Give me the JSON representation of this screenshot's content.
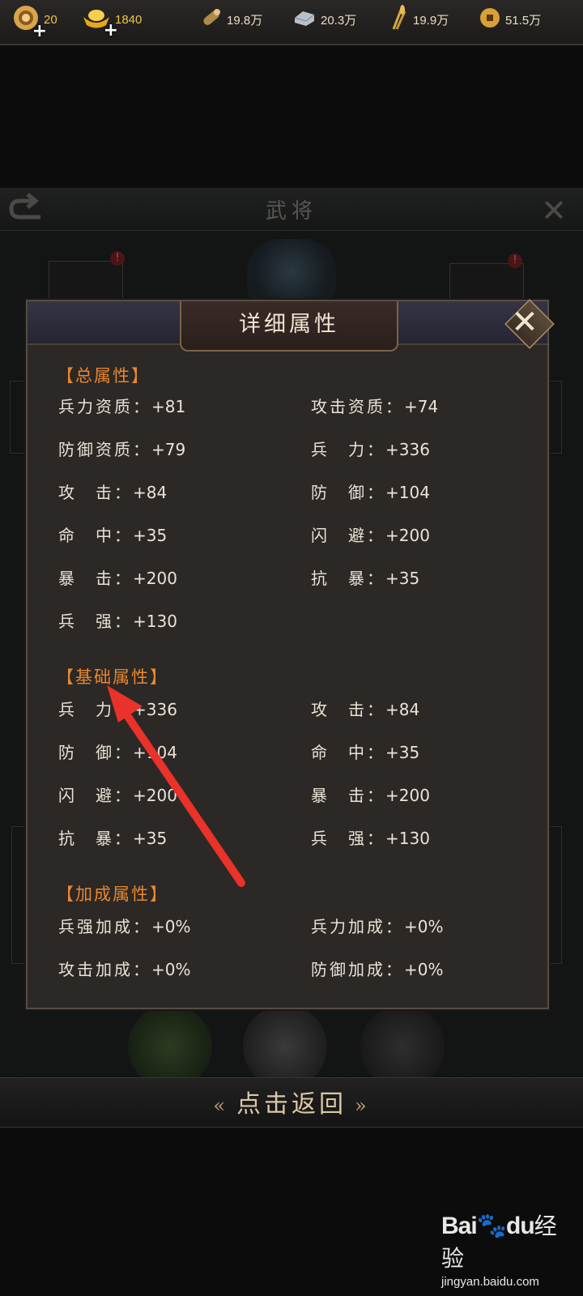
{
  "resources": {
    "jade": "20",
    "gold": "1840",
    "wood": "19.8万",
    "iron": "20.3万",
    "grain": "19.9万",
    "coin": "51.5万"
  },
  "background": {
    "title": "武将"
  },
  "dialog": {
    "title": "详细属性",
    "total": {
      "title": "【总属性】",
      "rows": [
        [
          "兵力资质：",
          "+81",
          "攻击资质：",
          "+74"
        ],
        [
          "防御资质：",
          "+79",
          "兵　力：",
          "+336"
        ],
        [
          "攻　击：",
          "+84",
          "防　御：",
          "+104"
        ],
        [
          "命　中：",
          "+35",
          "闪　避：",
          "+200"
        ],
        [
          "暴　击：",
          "+200",
          "抗　暴：",
          "+35"
        ],
        [
          "兵　强：",
          "+130",
          "",
          ""
        ]
      ]
    },
    "base": {
      "title": "【基础属性】",
      "rows": [
        [
          "兵　力：",
          "+336",
          "攻　击：",
          "+84"
        ],
        [
          "防　御：",
          "+104",
          "命　中：",
          "+35"
        ],
        [
          "闪　避：",
          "+200",
          "暴　击：",
          "+200"
        ],
        [
          "抗　暴：",
          "+35",
          "兵　强：",
          "+130"
        ]
      ]
    },
    "bonus": {
      "title": "【加成属性】",
      "rows": [
        [
          "兵强加成：",
          "+0%",
          "兵力加成：",
          "+0%"
        ],
        [
          "攻击加成：",
          "+0%",
          "防御加成：",
          "+0%"
        ]
      ]
    }
  },
  "footer": {
    "back_label": "点击返回",
    "left_arrow": "«",
    "right_arrow": "»"
  },
  "watermark": {
    "logo": "Bai",
    "logo2": "du",
    "cn": "经验",
    "url": "jingyan.baidu.com"
  },
  "colors": {
    "section_title": "#e8872e",
    "arrow_annotation": "#e8322a"
  }
}
